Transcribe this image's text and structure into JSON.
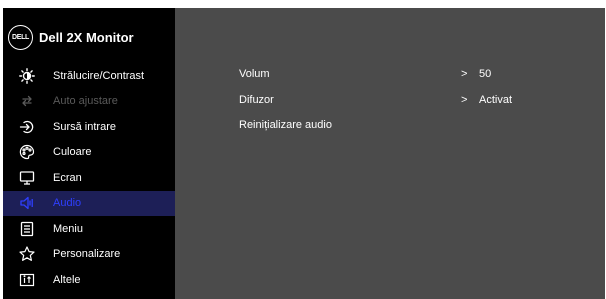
{
  "header": {
    "logo": "DELL",
    "title": "Dell 2X Monitor"
  },
  "sidebar": {
    "items": [
      {
        "label": "Strălucire/Contrast",
        "icon": "brightness-icon",
        "state": "normal"
      },
      {
        "label": "Auto ajustare",
        "icon": "auto-adjust-icon",
        "state": "disabled"
      },
      {
        "label": "Sursă intrare",
        "icon": "input-source-icon",
        "state": "normal"
      },
      {
        "label": "Culoare",
        "icon": "color-palette-icon",
        "state": "normal"
      },
      {
        "label": "Ecran",
        "icon": "display-icon",
        "state": "normal"
      },
      {
        "label": "Audio",
        "icon": "speaker-icon",
        "state": "selected"
      },
      {
        "label": "Meniu",
        "icon": "menu-icon",
        "state": "normal"
      },
      {
        "label": "Personalizare",
        "icon": "star-icon",
        "state": "normal"
      },
      {
        "label": "Altele",
        "icon": "info-icon",
        "state": "normal"
      }
    ]
  },
  "panel": {
    "options": [
      {
        "label": "Volum",
        "arrow": ">",
        "value": "50"
      },
      {
        "label": "Difuzor",
        "arrow": ">",
        "value": "Activat"
      },
      {
        "label": "Reinițializare audio"
      }
    ]
  },
  "colors": {
    "sidebar_bg": "#000000",
    "panel_bg": "#4b4b4b",
    "selected_bg": "#1d1f57",
    "selected_text": "#2e3fff",
    "disabled_text": "#5a5a5a"
  }
}
